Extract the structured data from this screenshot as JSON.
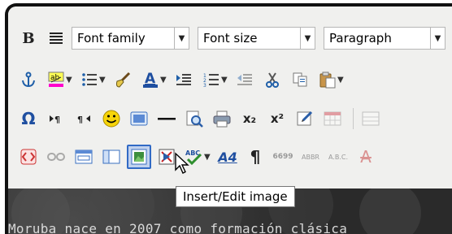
{
  "toolbar": {
    "font_family": "Font family",
    "font_size": "Font size",
    "block_format": "Paragraph"
  },
  "icons": {
    "row1": [
      "bold-icon",
      "justify-full-icon"
    ],
    "row2": [
      "anchor-icon",
      "highlight-color-icon",
      "bullet-list-icon",
      "cleanup-brush-icon",
      "text-color-icon",
      "indent-icon",
      "numbered-list-icon",
      "outdent-icon",
      "cut-icon",
      "copy-icon",
      "paste-icon"
    ],
    "row3": [
      "omega-icon",
      "ltr-icon",
      "rtl-icon",
      "emoticon-icon",
      "media-icon",
      "horizontal-rule-icon",
      "preview-icon",
      "print-icon",
      "subscript-icon",
      "superscript-icon",
      "edit-icon",
      "table-icon"
    ],
    "row4": [
      "code-icon",
      "unlink-icon",
      "frame-icon",
      "layer-icon",
      "insert-image-icon",
      "remove-format-icon",
      "spellcheck-icon",
      "style-icon",
      "pilcrow-icon",
      "quote-icon",
      "abbr-icon",
      "acronym-icon",
      "strikethrough-icon"
    ]
  },
  "tooltip": {
    "text": "Insert/Edit image"
  },
  "editor": {
    "text": "Moruba nace en 2007 como formación clásica"
  },
  "labels": {
    "bold": "B",
    "omega": "Ω",
    "pilcrow": "¶",
    "quote": "6699",
    "abbr": "ABBR",
    "acronym": "A.B.C.",
    "sub": "x₂",
    "sup": "x²",
    "abc": "ABC",
    "a4": "A4",
    "strike": "A",
    "text_a": "A"
  },
  "colors": {
    "accent": "#316ac5",
    "pressed_bg": "#c1d2ee",
    "editor_bg": "#2b2b2b"
  }
}
